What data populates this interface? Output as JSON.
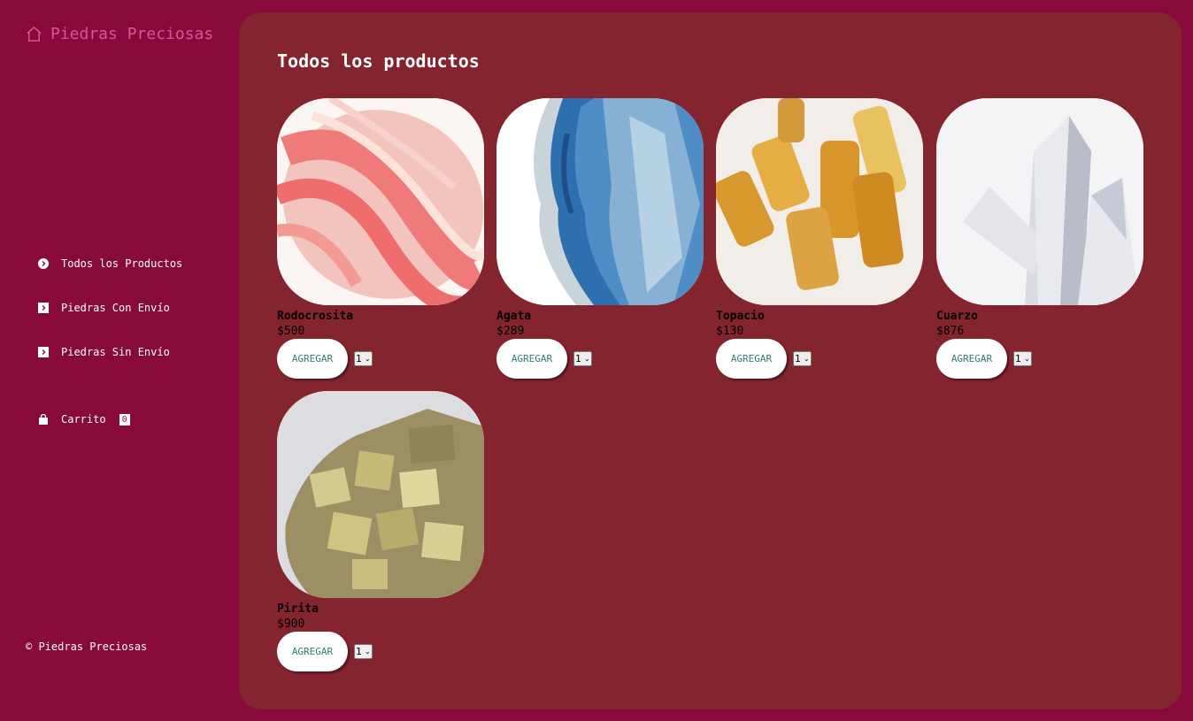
{
  "brand": {
    "name": "Piedras Preciosas",
    "icon": "home-icon",
    "color": "#E24F9A"
  },
  "nav": [
    {
      "label": "Todos los Productos",
      "icon": "circle-arrow-icon"
    },
    {
      "label": "Piedras Con Envío",
      "icon": "square-arrow-icon"
    },
    {
      "label": "Piedras Sin Envío",
      "icon": "square-arrow-icon"
    }
  ],
  "cart": {
    "label": "Carrito",
    "count": "0",
    "icon": "shopping-bag-icon"
  },
  "footer": {
    "text": "© Piedras Preciosas"
  },
  "main": {
    "title": "Todos los productos"
  },
  "products": [
    {
      "name": "Rodocrosita",
      "price": "$500",
      "button": "AGREGAR",
      "qty": "1"
    },
    {
      "name": "Agata",
      "price": "$289",
      "button": "AGREGAR",
      "qty": "1"
    },
    {
      "name": "Topacio",
      "price": "$130",
      "button": "AGREGAR",
      "qty": "1"
    },
    {
      "name": "Cuarzo",
      "price": "$876",
      "button": "AGREGAR",
      "qty": "1"
    },
    {
      "name": "Pirita",
      "price": "$900",
      "button": "AGREGAR",
      "qty": "1"
    }
  ],
  "colors": {
    "background": "#870A3A",
    "panel": "#84242F",
    "button_text": "#2E7D74"
  }
}
